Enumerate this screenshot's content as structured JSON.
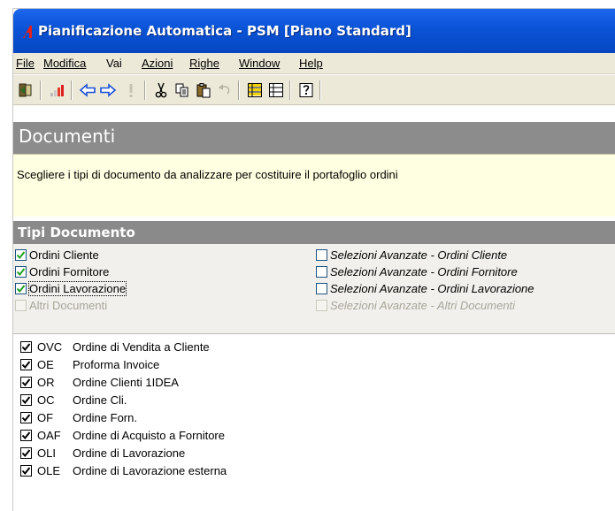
{
  "window": {
    "title": "Pianificazione Automatica - PSM  [Piano Standard]"
  },
  "menu": {
    "items": [
      {
        "label": "File",
        "name": "menu-file"
      },
      {
        "label": "Modifica",
        "name": "menu-modifica"
      },
      {
        "label": "Vai",
        "name": "menu-vai"
      },
      {
        "label": "Azioni",
        "name": "menu-azioni"
      },
      {
        "label": "Righe",
        "name": "menu-righe"
      },
      {
        "label": "Window",
        "name": "menu-window"
      },
      {
        "label": "Help",
        "name": "menu-help"
      }
    ]
  },
  "toolbar": {
    "buttons": [
      "exit-icon",
      "signal-icon",
      "arrow-left-icon",
      "arrow-right-icon",
      "exclamation-icon",
      "cut-icon",
      "copy-icon",
      "paste-icon",
      "undo-icon",
      "list-highlight-icon",
      "list-icon",
      "help-icon"
    ]
  },
  "page": {
    "title": "Documenti",
    "description": "Scegliere i tipi di documento da analizzare per costituire il portafoglio ordini"
  },
  "section": {
    "title": "Tipi Documento"
  },
  "options": {
    "left": [
      {
        "label": "Ordini Cliente",
        "checked": true,
        "enabled": true
      },
      {
        "label": "Ordini Fornitore",
        "checked": true,
        "enabled": true
      },
      {
        "label": "Ordini Lavorazione",
        "checked": true,
        "enabled": true,
        "focused": true
      },
      {
        "label": "Altri Documenti",
        "checked": false,
        "enabled": false
      }
    ],
    "right": [
      {
        "label": "Selezioni Avanzate - Ordini Cliente",
        "checked": false,
        "enabled": true
      },
      {
        "label": "Selezioni Avanzate - Ordini Fornitore",
        "checked": false,
        "enabled": true
      },
      {
        "label": "Selezioni Avanzate - Ordini Lavorazione",
        "checked": false,
        "enabled": true
      },
      {
        "label": "Selezioni Avanzate - Altri Documenti",
        "checked": false,
        "enabled": false
      }
    ]
  },
  "documents": [
    {
      "code": "OVC",
      "description": "Ordine di Vendita a Cliente",
      "checked": true
    },
    {
      "code": "OE",
      "description": "Proforma Invoice",
      "checked": true
    },
    {
      "code": "OR",
      "description": "Ordine Clienti 1IDEA",
      "checked": true
    },
    {
      "code": "OC",
      "description": "Ordine Cli.",
      "checked": true
    },
    {
      "code": "OF",
      "description": "Ordine Forn.",
      "checked": true
    },
    {
      "code": "OAF",
      "description": "Ordine di Acquisto a Fornitore",
      "checked": true
    },
    {
      "code": "OLI",
      "description": "Ordine di Lavorazione",
      "checked": true
    },
    {
      "code": "OLE",
      "description": "Ordine di Lavorazione esterna",
      "checked": true
    }
  ]
}
